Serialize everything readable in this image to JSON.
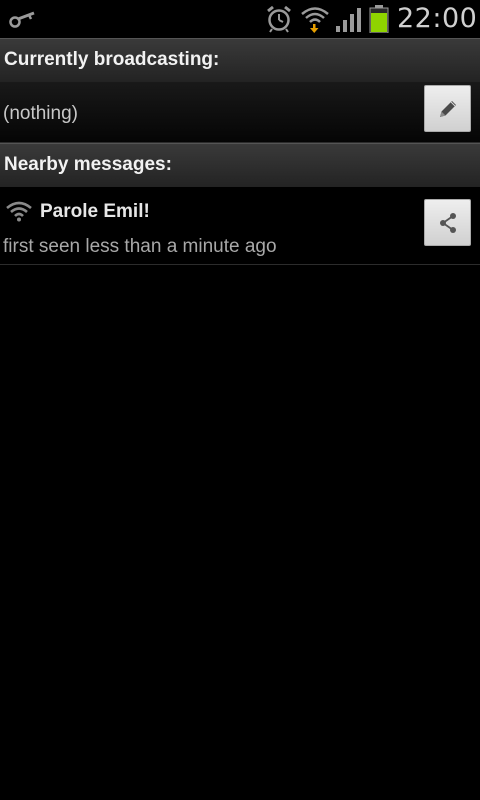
{
  "status_bar": {
    "time": "22:00",
    "icons": [
      "key-icon",
      "alarm-icon",
      "wifi-icon",
      "signal-icon",
      "battery-icon"
    ],
    "battery_color": "#8fd400"
  },
  "broadcasting": {
    "header": "Currently broadcasting:",
    "value": "(nothing)",
    "edit_icon": "pencil-icon"
  },
  "nearby": {
    "header": "Nearby messages:",
    "messages": [
      {
        "title": "Parole Emil!",
        "subtitle": "first seen less than a minute ago",
        "icon": "wifi-icon",
        "action_icon": "share-icon"
      }
    ]
  }
}
